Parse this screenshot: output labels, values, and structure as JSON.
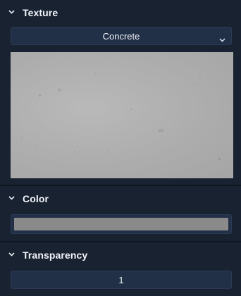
{
  "texture": {
    "title": "Texture",
    "selected": "Concrete"
  },
  "color": {
    "title": "Color",
    "value": "#8a8a8a"
  },
  "transparency": {
    "title": "Transparency",
    "value": "1"
  },
  "icons": {
    "section_toggle": "chevron-down-icon",
    "dropdown_toggle": "chevron-down-icon"
  }
}
